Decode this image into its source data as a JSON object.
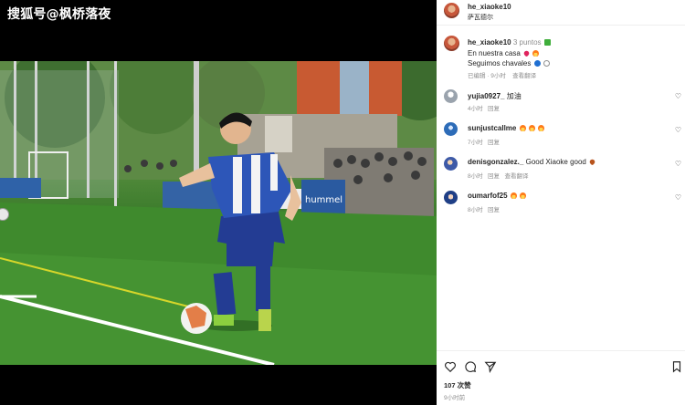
{
  "watermark": "搜狐号@枫桥落夜",
  "post": {
    "author": "he_xiaoke10",
    "location": "萨瓦德尔"
  },
  "caption": {
    "author": "he_xiaoke10",
    "line1": "3 puntos",
    "line2": "En nuestra casa",
    "line3": "Seguimos chavales",
    "time": "已编辑 · 9小时",
    "translate": "查看翻译"
  },
  "comments": [
    {
      "user": "yujia0927_",
      "text": "加油",
      "time": "4小时",
      "reply": "回复",
      "translate": ""
    },
    {
      "user": "sunjustcallme",
      "text": "",
      "time": "7小时",
      "reply": "回复",
      "translate": ""
    },
    {
      "user": "denisgonzalez._",
      "text": "Good Xiaoke good",
      "time": "8小时",
      "reply": "回复",
      "translate": "查看翻译"
    },
    {
      "user": "oumarfof25",
      "text": "",
      "time": "8小时",
      "reply": "回复",
      "translate": ""
    }
  ],
  "actions": {
    "likes": "107 次赞",
    "posted": "9小时前"
  },
  "icons": [
    "like-icon",
    "comment-icon",
    "share-icon",
    "save-icon",
    "heart-small-icon"
  ],
  "colors": {
    "panel_bg": "#ffffff",
    "text": "#262626",
    "muted": "#8e8e8e",
    "backdrop": "#000000"
  }
}
